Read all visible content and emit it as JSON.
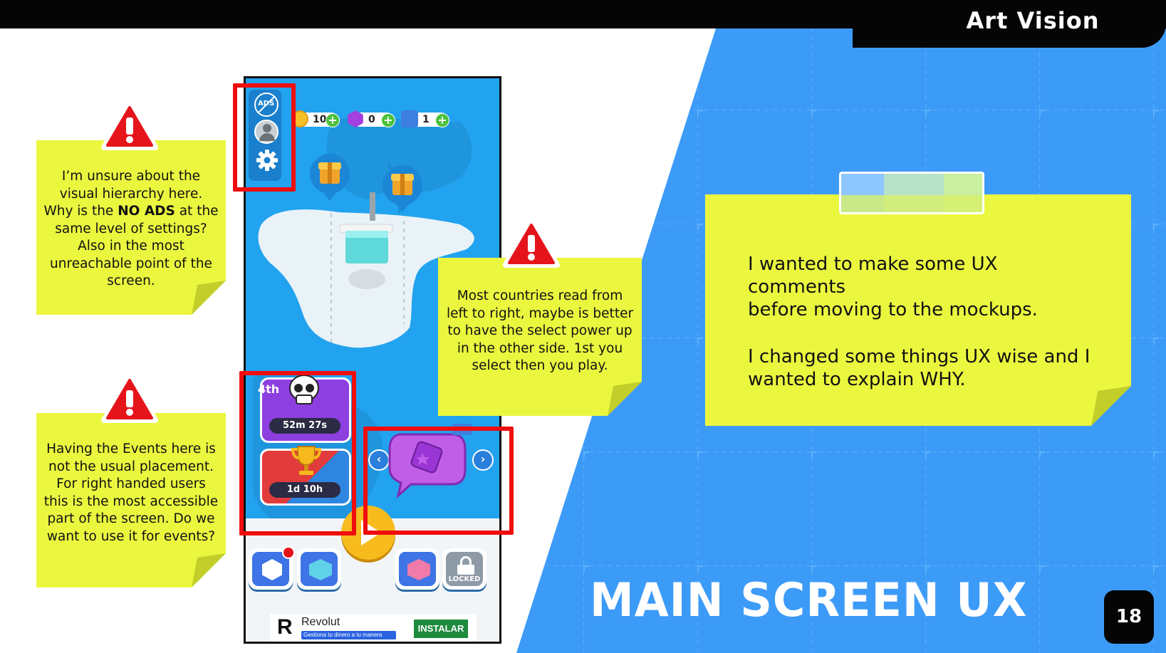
{
  "brand": {
    "name": "Art Vision"
  },
  "slide": {
    "title": "MAIN SCREEN UX",
    "page_number": "18"
  },
  "notes": {
    "visual_hierarchy": {
      "line1": "I’m unsure about the",
      "line2": "visual hierarchy here.",
      "line3_pre": "Why is the ",
      "line3_bold": "NO ADS",
      "line3_post": " at the",
      "line4": "same level of settings?",
      "line5": "Also in the most",
      "line6": "unreachable point of the",
      "line7": "screen."
    },
    "events_placement": {
      "lines": [
        "Having the Events here is",
        "not the usual placement.",
        "For right handed users",
        "this is the most accessible",
        "part of the screen. Do we",
        "want to use it for events?"
      ]
    },
    "reading_direction": {
      "lines": [
        "Most countries read from",
        "left to right, maybe is better",
        "to have the select power up",
        "in the other side. 1st you",
        "select then you play."
      ]
    },
    "intro": {
      "paragraph1_line1": "I wanted to make some UX comments",
      "paragraph1_line2": "before moving to the mockups.",
      "paragraph2_line1": "I changed some things UX wise and I",
      "paragraph2_line2": "wanted to explain WHY."
    }
  },
  "phone": {
    "currencies": [
      {
        "name": "coins",
        "value": "10"
      },
      {
        "name": "gems",
        "value": "0"
      },
      {
        "name": "skips",
        "value": "1"
      }
    ],
    "side_buttons": [
      "no-ads",
      "profile",
      "settings"
    ],
    "side_labels": {
      "no_ads": "ADS"
    },
    "events": {
      "skull": {
        "rank": "4th",
        "timer": "52m 27s"
      },
      "trophy": {
        "timer": "1d 10h"
      }
    },
    "bottom_bar": {
      "locked_label": "LOCKED"
    },
    "ad": {
      "brand": "Revolut",
      "tagline": "Gestiona tu dinero a tu manera",
      "cta": "INSTALAR",
      "logo_letter": "R"
    }
  },
  "colors": {
    "background_blue": "#3d9bf8",
    "note_yellow": "#ebf73f",
    "highlight_red": "#ef0e0e",
    "warning_red": "#e5141b"
  }
}
